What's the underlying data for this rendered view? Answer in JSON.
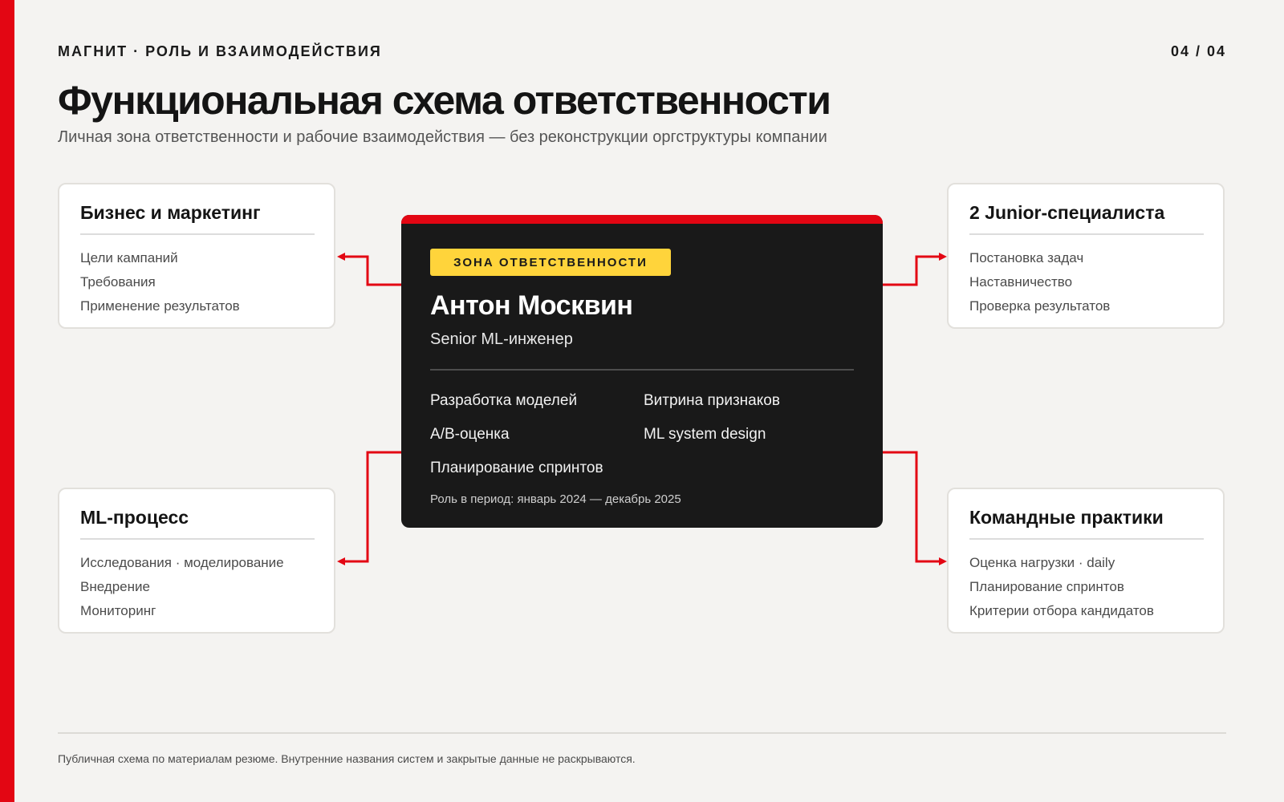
{
  "header": {
    "kicker": "МАГНИТ · РОЛЬ И ВЗАИМОДЕЙСТВИЯ",
    "pager": "04 / 04",
    "title": "Функциональная схема ответственности",
    "subtitle": "Личная зона ответственности и рабочие взаимодействия — без реконструкции оргструктуры компании"
  },
  "center": {
    "badge": "ЗОНА ОТВЕТСТВЕННОСТИ",
    "name": "Антон Москвин",
    "role": "Senior ML-инженер",
    "skills": [
      "Разработка моделей",
      "Витрина признаков",
      "A/B-оценка",
      "ML system design",
      "Планирование спринтов"
    ],
    "period": "Роль в период: январь 2024 — декабрь 2025"
  },
  "cards": {
    "business": {
      "title": "Бизнес и маркетинг",
      "items": [
        "Цели кампаний",
        "Требования",
        "Применение результатов"
      ]
    },
    "ml_process": {
      "title": "ML-процесс",
      "items": [
        "Исследования · моделирование",
        "Внедрение",
        "Мониторинг"
      ]
    },
    "juniors": {
      "title": "2 Junior-специалиста",
      "items": [
        "Постановка задач",
        "Наставничество",
        "Проверка результатов"
      ]
    },
    "team": {
      "title": "Командные практики",
      "items": [
        "Оценка нагрузки · daily",
        "Планирование спринтов",
        "Критерии отбора кандидатов"
      ]
    }
  },
  "footer": {
    "note": "Публичная схема по материалам резюме. Внутренние названия систем и закрытые данные не раскрываются."
  },
  "colors": {
    "accent": "#e30613",
    "badge": "#ffd43b",
    "center_bg": "#191919",
    "page_bg": "#f4f3f1"
  }
}
